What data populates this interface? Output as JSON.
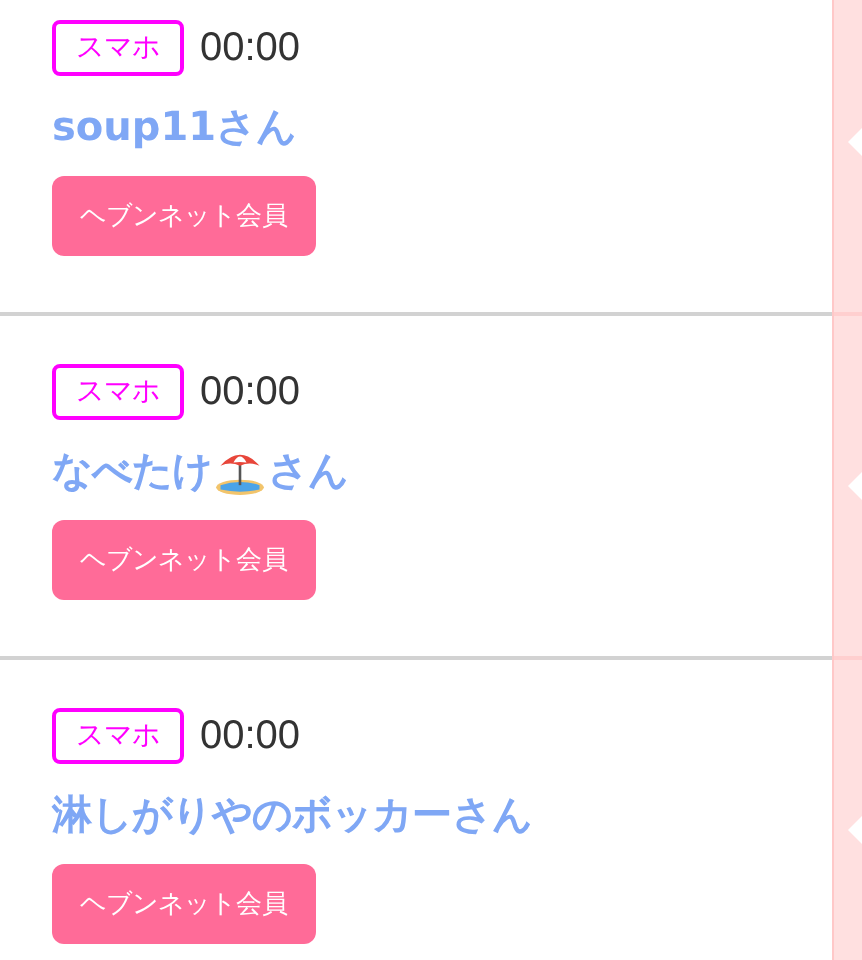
{
  "posts": [
    {
      "device": "スマホ",
      "time": "00:00",
      "name": "soup11",
      "beach_icon": false,
      "honorific": "さん",
      "member_label": "ヘブンネット会員"
    },
    {
      "device": "スマホ",
      "time": "00:00",
      "name": "なべたけ",
      "beach_icon": true,
      "honorific": "さん",
      "member_label": "ヘブンネット会員"
    },
    {
      "device": "スマホ",
      "time": "00:00",
      "name": "淋しがりやのボッカー",
      "beach_icon": false,
      "honorific": "さん",
      "member_label": "ヘブンネット会員"
    }
  ]
}
